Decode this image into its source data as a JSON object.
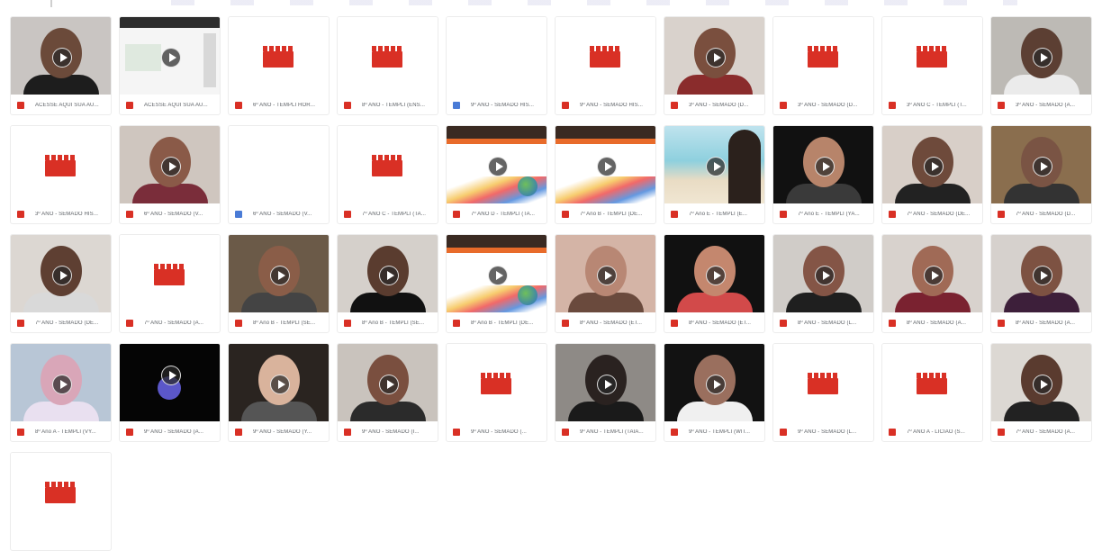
{
  "grid": {
    "tiles": [
      {
        "label": "ACESSE AQUI SUA AU...",
        "icon": "video",
        "thumb": "person",
        "bg": "#c9c5c2",
        "skin": "#6b4a3a",
        "shirt": "#1d1d1d",
        "play": true
      },
      {
        "label": "ACESSE AQUI SUA AU...",
        "icon": "video",
        "thumb": "screen",
        "bg": "#f3f3f3",
        "play": true
      },
      {
        "label": "6º ANO - TEMPLI HOR...",
        "icon": "video",
        "thumb": "clap"
      },
      {
        "label": "8º ANO - TEMPLI (ENS...",
        "icon": "video",
        "thumb": "clap"
      },
      {
        "label": "9º ANO - SEMADO HIS...",
        "icon": "doc",
        "thumb": "blank"
      },
      {
        "label": "9º ANO - SEMADO HIS...",
        "icon": "video",
        "thumb": "clap"
      },
      {
        "label": "3º ANO - SEMADO (D...",
        "icon": "video",
        "thumb": "person",
        "bg": "#d9d2cc",
        "skin": "#7a4f3e",
        "shirt": "#8a2c2c",
        "play": true
      },
      {
        "label": "3º ANO - SEMADO (D...",
        "icon": "video",
        "thumb": "clap"
      },
      {
        "label": "3º ANO C - TEMPLI (T...",
        "icon": "video",
        "thumb": "clap"
      },
      {
        "label": "3º ANO - SEMADO (A...",
        "icon": "video",
        "thumb": "person",
        "bg": "#bdbab5",
        "skin": "#5c3f33",
        "shirt": "#ebebeb",
        "play": true
      },
      {
        "label": "3º ANO - SEMADO HIS...",
        "icon": "video",
        "thumb": "clap"
      },
      {
        "label": "6º ANO - SEMADO (V...",
        "icon": "video",
        "thumb": "person",
        "bg": "#cfc6bf",
        "skin": "#8a5a48",
        "shirt": "#7a2d3a",
        "play": true
      },
      {
        "label": "6º ANO - SEMADO (V...",
        "icon": "doc",
        "thumb": "blank"
      },
      {
        "label": "7º ANO C - TEMPLI (TA...",
        "icon": "video",
        "thumb": "clap"
      },
      {
        "label": "7º ANO D - TEMPLI (TA...",
        "icon": "video",
        "thumb": "slide",
        "play": true
      },
      {
        "label": "7º Ano B - TEMPLI (DE...",
        "icon": "video",
        "thumb": "slide2",
        "play": true
      },
      {
        "label": "7º Ano E - TEMPLI (E...",
        "icon": "video",
        "thumb": "beach",
        "play": true
      },
      {
        "label": "7º Ano E - TEMPLI (YA...",
        "icon": "video",
        "thumb": "person",
        "bg": "#111111",
        "skin": "#b7846a",
        "shirt": "#3a3a3a",
        "play": true
      },
      {
        "label": "7º ANO - SEMADO (DE...",
        "icon": "video",
        "thumb": "person",
        "bg": "#d8cfc8",
        "skin": "#6e4a3b",
        "shirt": "#222222",
        "play": true
      },
      {
        "label": "7º ANO - SEMADO (D...",
        "icon": "video",
        "thumb": "person",
        "bg": "#8a6e4e",
        "skin": "#7a5444",
        "shirt": "#333333",
        "play": true
      },
      {
        "label": "7º ANO - SEMADO (DE...",
        "icon": "video",
        "thumb": "person",
        "bg": "#dcd7d2",
        "skin": "#5e3f32",
        "shirt": "#d9d9d9",
        "play": true
      },
      {
        "label": "7º ANO - SEMADO (A...",
        "icon": "video",
        "thumb": "clap"
      },
      {
        "label": "8º Ano B - TEMPLI (SE...",
        "icon": "video",
        "thumb": "person",
        "bg": "#6b5a48",
        "skin": "#8a5d48",
        "shirt": "#444444",
        "play": true
      },
      {
        "label": "8º Ano B - TEMPLI (SE...",
        "icon": "video",
        "thumb": "person",
        "bg": "#d5d0cb",
        "skin": "#5a3c2f",
        "shirt": "#111111",
        "play": true
      },
      {
        "label": "8º Ano B - TEMPLI (DE...",
        "icon": "video",
        "thumb": "slide",
        "play": true
      },
      {
        "label": "8º ANO - SEMADO (ET...",
        "icon": "video",
        "thumb": "person",
        "bg": "#d4b4a6",
        "skin": "#b88774",
        "shirt": "#6a4a3d",
        "play": true
      },
      {
        "label": "8º ANO - SEMADO (ET...",
        "icon": "video",
        "thumb": "person",
        "bg": "#111111",
        "skin": "#c4876e",
        "shirt": "#d24a4a",
        "play": true
      },
      {
        "label": "8º ANO - SEMADO (L...",
        "icon": "video",
        "thumb": "person",
        "bg": "#d0ccc8",
        "skin": "#845546",
        "shirt": "#1f1f1f",
        "play": true
      },
      {
        "label": "8º ANO - SEMADO (A...",
        "icon": "video",
        "thumb": "person",
        "bg": "#d8d2cd",
        "skin": "#a06a56",
        "shirt": "#7a2230",
        "play": true
      },
      {
        "label": "8º ANO - SEMADO (A...",
        "icon": "video",
        "thumb": "person",
        "bg": "#d6d1cd",
        "skin": "#7d5242",
        "shirt": "#3d1f3a",
        "play": true
      },
      {
        "label": "8º Ano A - TEMPLI (VY...",
        "icon": "video",
        "thumb": "person",
        "bg": "#b8c6d6",
        "skin": "#d9a6b8",
        "shirt": "#e9e0f0",
        "play": true
      },
      {
        "label": "9º ANO - SEMADO (A...",
        "icon": "video",
        "thumb": "dark",
        "play": true
      },
      {
        "label": "9º ANO - SEMADO (Y...",
        "icon": "video",
        "thumb": "person",
        "bg": "#2a2420",
        "skin": "#d9b39c",
        "shirt": "#555555",
        "play": true
      },
      {
        "label": "9º ANO - SEMADO (I...",
        "icon": "video",
        "thumb": "person",
        "bg": "#c9c3bd",
        "skin": "#7a4f3f",
        "shirt": "#2b2b2b",
        "play": true
      },
      {
        "label": "9º ANO - SEMADO (...",
        "icon": "video",
        "thumb": "clap"
      },
      {
        "label": "9º ANO - TEMPLI (TAIA...",
        "icon": "video",
        "thumb": "person",
        "bg": "#8e8a86",
        "skin": "#2a2220",
        "shirt": "#1a1a1a",
        "play": true
      },
      {
        "label": "9º ANO - TEMPLI (WIT...",
        "icon": "video",
        "thumb": "person",
        "bg": "#121212",
        "skin": "#9a6f5e",
        "shirt": "#f0f0f0",
        "play": true
      },
      {
        "label": "9º ANO - SEMADO (L...",
        "icon": "video",
        "thumb": "clap"
      },
      {
        "label": "7º ANO A - LICIAO (S...",
        "icon": "video",
        "thumb": "clap"
      },
      {
        "label": "7º ANO - SEMADO (A...",
        "icon": "video",
        "thumb": "person",
        "bg": "#dcd8d3",
        "skin": "#5a3b2f",
        "shirt": "#222222",
        "play": true
      },
      {
        "label": "",
        "icon": "video",
        "thumb": "clap"
      }
    ]
  },
  "colors": {
    "video": "#d93025",
    "doc": "#4a7bd6"
  }
}
